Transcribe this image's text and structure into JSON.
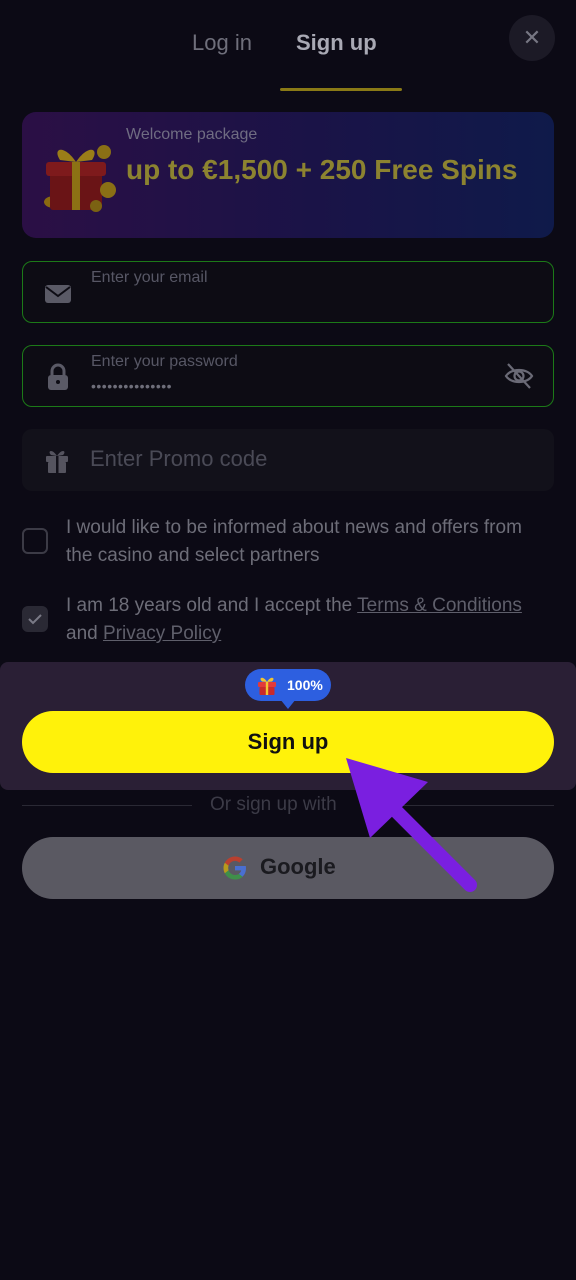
{
  "tabs": [
    {
      "label": "Log in",
      "active": false
    },
    {
      "label": "Sign up",
      "active": true
    }
  ],
  "close_icon": "close-icon",
  "promo": {
    "subtitle": "Welcome package",
    "title": "up to €1,500 + 250 Free Spins"
  },
  "email_field": {
    "label": "Enter your email",
    "value": "",
    "icon": "envelope-icon"
  },
  "password_field": {
    "label": "Enter your password",
    "value": "•••••••••••••••",
    "icon": "lock-icon",
    "toggle_icon": "eye-off-icon"
  },
  "promo_code_field": {
    "placeholder": "Enter Promo code",
    "icon": "gift-icon"
  },
  "checkboxes": [
    {
      "text": "I would like to be informed about news and offers from the casino and select partners",
      "checked": false
    },
    {
      "text_before": "I am 18 years old and I accept the ",
      "terms_link": "Terms & Conditions",
      "text_and": " and ",
      "privacy_link": "Privacy Policy",
      "checked": true
    }
  ],
  "badge": {
    "text": "100%",
    "icon": "gift-icon"
  },
  "signup_button": {
    "label": "Sign up"
  },
  "divider": {
    "text": "Or sign up with"
  },
  "google_button": {
    "label": "Google",
    "icon": "google-icon"
  },
  "colors": {
    "accent_yellow": "#fff20a",
    "badge_blue": "#2d5fe0",
    "arrow_purple": "#7a1fe0",
    "field_border_green": "#1c7a18"
  }
}
